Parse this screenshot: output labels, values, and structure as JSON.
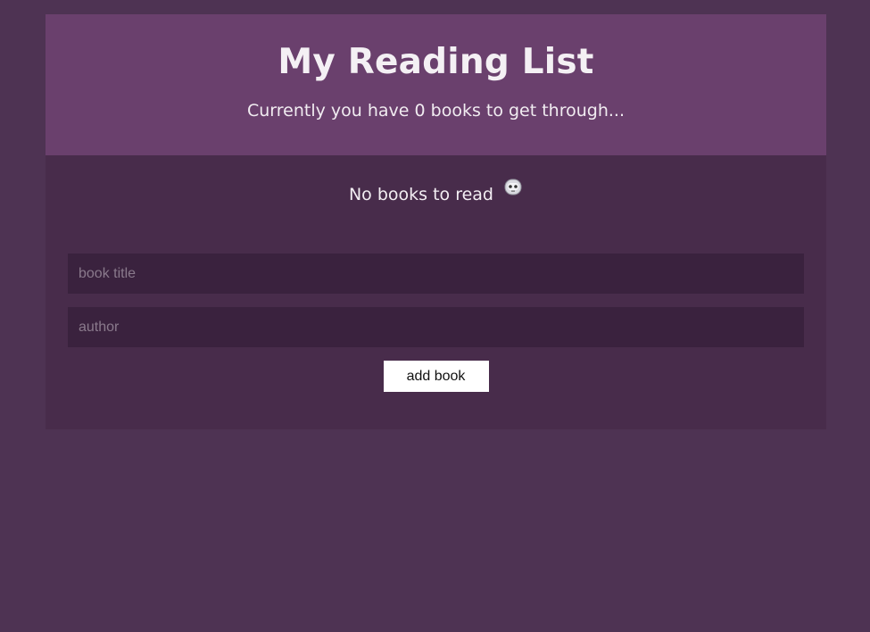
{
  "header": {
    "title": "My Reading List",
    "subtitle": "Currently you have 0 books to get through..."
  },
  "book_list": {
    "empty_message": "No books to read",
    "empty_icon": "robot-face-icon"
  },
  "form": {
    "title_placeholder": "book title",
    "author_placeholder": "author",
    "submit_label": "add book"
  },
  "colors": {
    "page_background": "#4e3353",
    "header_background": "#6a406d",
    "content_background": "#482c4b",
    "input_background": "#3a223e",
    "button_background": "#ffffff"
  }
}
